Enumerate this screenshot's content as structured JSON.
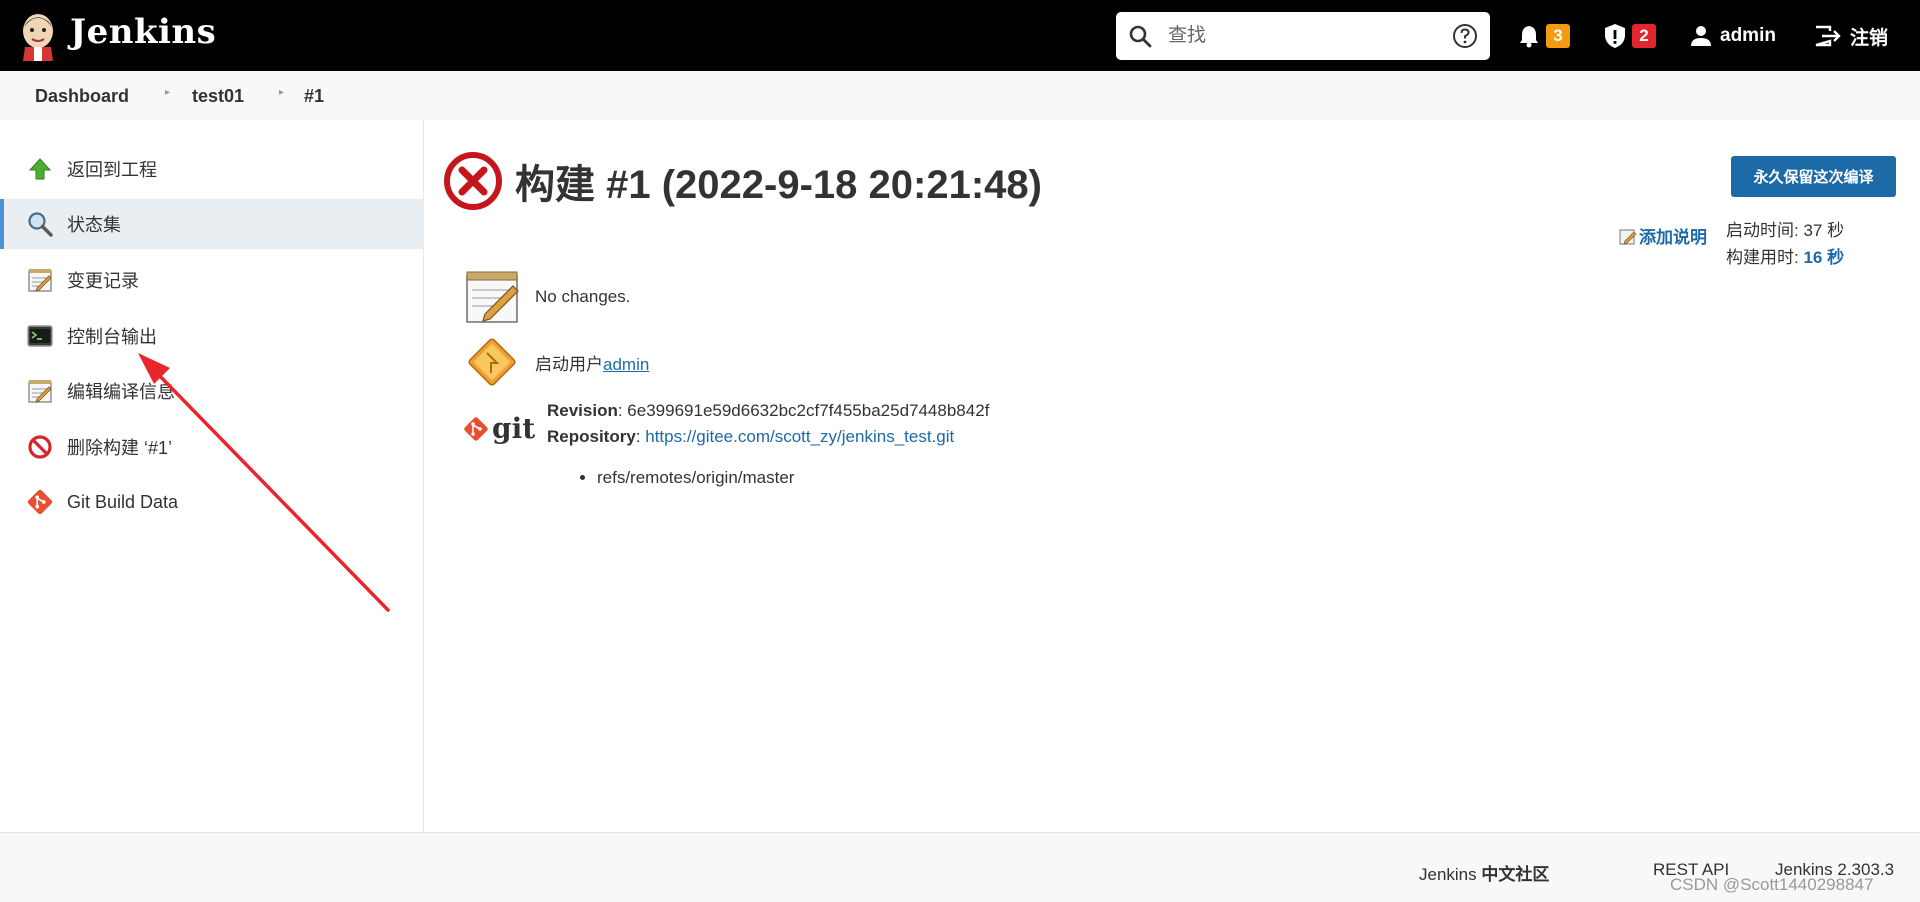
{
  "header": {
    "brand": "Jenkins",
    "search_placeholder": "查找",
    "notifications_count": "3",
    "security_count": "2",
    "user": "admin",
    "logout": "注销",
    "colors": {
      "bar": "#000000",
      "notif_badge": "#f49b14",
      "security_badge": "#e3262d"
    }
  },
  "breadcrumb": [
    "Dashboard",
    "test01",
    "#1"
  ],
  "sidebar": {
    "items": [
      {
        "label": "返回到工程",
        "icon": "up-arrow-icon"
      },
      {
        "label": "状态集",
        "icon": "magnifier-icon",
        "active": true
      },
      {
        "label": "变更记录",
        "icon": "notepad-icon"
      },
      {
        "label": "控制台输出",
        "icon": "terminal-icon"
      },
      {
        "label": "编辑编译信息",
        "icon": "notepad-icon"
      },
      {
        "label": "删除构建 ‘#1’",
        "icon": "no-entry-icon"
      },
      {
        "label": "Git Build Data",
        "icon": "git-icon"
      }
    ]
  },
  "build": {
    "title": "构建 #1 (2022-9-18 20:21:48)",
    "status": "failed",
    "keep_button": "永久保留这次编译",
    "add_description": "添加说明",
    "started_label": "启动时间: 37 秒",
    "duration_label": "构建用时: ",
    "duration_value": "16 秒",
    "changes_text": "No changes.",
    "started_by_prefix": "启动用户",
    "started_by_user": "admin",
    "git": {
      "logo_text": "git",
      "revision_label": "Revision",
      "revision_value": ": 6e399691e59d6632bc2cf7f455ba25d7448b842f",
      "repository_label": "Repository",
      "repository_sep": ": ",
      "repository_url": "https://gitee.com/scott_zy/jenkins_test.git",
      "branches": [
        "refs/remotes/origin/master"
      ]
    }
  },
  "footer": {
    "community_prefix": "Jenkins ",
    "community_bold": "中文社区",
    "rest_api": "REST API",
    "version": "Jenkins 2.303.3"
  },
  "watermark": "CSDN @Scott1440298847"
}
